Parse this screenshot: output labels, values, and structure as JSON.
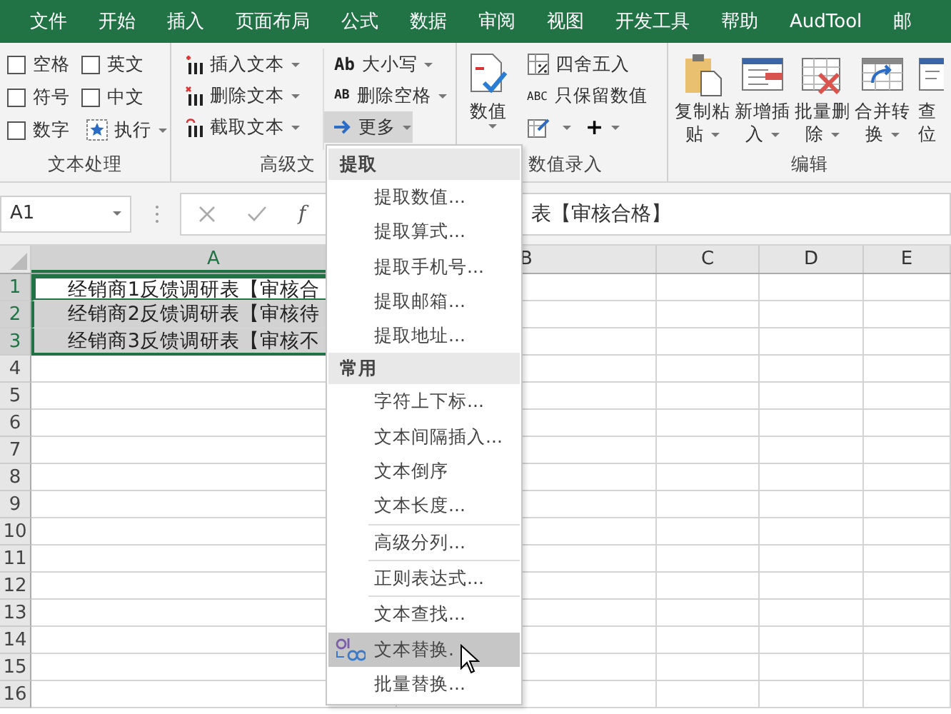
{
  "menu_tabs": [
    "文件",
    "开始",
    "插入",
    "页面布局",
    "公式",
    "数据",
    "审阅",
    "视图",
    "开发工具",
    "帮助",
    "AudTool",
    "邮"
  ],
  "ribbon": {
    "text_group": {
      "label": "文本处理",
      "checkboxes": [
        {
          "label": "空格",
          "checked": false
        },
        {
          "label": "英文",
          "checked": false
        },
        {
          "label": "符号",
          "checked": false
        },
        {
          "label": "中文",
          "checked": false
        },
        {
          "label": "数字",
          "checked": false
        }
      ],
      "run_button": "执行"
    },
    "advanced_group": {
      "label": "高级文",
      "text_buttons": [
        "插入文本",
        "删除文本",
        "截取文本"
      ],
      "case_button": {
        "icon_text": "Ab",
        "label": "大小写"
      },
      "trim_button": {
        "icon_text": "AB",
        "label": "删除空格"
      },
      "more_button": {
        "label": "更多",
        "pressed": true
      }
    },
    "number_group": {
      "label": "数值录入",
      "number_button": "数值",
      "round_button": "四舍五入",
      "keep_numbers_button": {
        "icon_text": "ABC",
        "label": "只保留数值"
      },
      "plus_button": "+"
    },
    "edit_group": {
      "label": "编辑",
      "buttons": [
        {
          "line_1": "复制粘",
          "line_2": "贴",
          "dropdown": true
        },
        {
          "line_1": "新增插",
          "line_2": "入",
          "dropdown": true
        },
        {
          "line_1": "批量删",
          "line_2": "除",
          "dropdown": true
        },
        {
          "line_1": "合并转",
          "line_2": "换",
          "dropdown": true
        },
        {
          "line_1": "查",
          "line_2": "位",
          "dropdown": false
        }
      ]
    }
  },
  "formula_bar": {
    "cell_reference": "A1",
    "function_label": "f",
    "formula_text": "表【审核合格】"
  },
  "columns": [
    {
      "label": "A",
      "selected": true
    },
    {
      "label": "B",
      "selected": false
    },
    {
      "label": "C",
      "selected": false
    },
    {
      "label": "D",
      "selected": false
    },
    {
      "label": "E",
      "selected": false
    }
  ],
  "rows": [
    {
      "number": "1",
      "cell_a": "经销商1反馈调研表【审核合",
      "selected": true,
      "active": true
    },
    {
      "number": "2",
      "cell_a": "经销商2反馈调研表【审核待",
      "selected": true,
      "active": false
    },
    {
      "number": "3",
      "cell_a": "经销商3反馈调研表【审核不",
      "selected": true,
      "active": false
    },
    {
      "number": "4",
      "selected": false,
      "active": false
    },
    {
      "number": "5",
      "selected": false,
      "active": false
    },
    {
      "number": "6",
      "selected": false,
      "active": false
    },
    {
      "number": "7",
      "selected": false,
      "active": false
    },
    {
      "number": "8",
      "selected": false,
      "active": false
    },
    {
      "number": "9",
      "selected": false,
      "active": false
    },
    {
      "number": "10",
      "selected": false,
      "active": false
    },
    {
      "number": "11",
      "selected": false,
      "active": false
    },
    {
      "number": "12",
      "selected": false,
      "active": false
    },
    {
      "number": "13",
      "selected": false,
      "active": false
    },
    {
      "number": "14",
      "selected": false,
      "active": false
    },
    {
      "number": "15",
      "selected": false,
      "active": false
    },
    {
      "number": "16",
      "selected": false,
      "active": false
    }
  ],
  "dropdown_menu": {
    "items": [
      {
        "kind": "header",
        "label": "提取"
      },
      {
        "kind": "item",
        "label": "提取数值...",
        "separator": false,
        "selected": false
      },
      {
        "kind": "item",
        "label": "提取算式...",
        "separator": false,
        "selected": false
      },
      {
        "kind": "item",
        "label": "提取手机号...",
        "separator": false,
        "selected": false
      },
      {
        "kind": "item",
        "label": "提取邮箱...",
        "separator": false,
        "selected": false
      },
      {
        "kind": "item",
        "label": "提取地址...",
        "separator": false,
        "selected": false
      },
      {
        "kind": "header",
        "label": "常用"
      },
      {
        "kind": "item",
        "label": "字符上下标...",
        "separator": false,
        "selected": false
      },
      {
        "kind": "item",
        "label": "文本间隔插入...",
        "separator": false,
        "selected": false
      },
      {
        "kind": "item",
        "label": "文本倒序",
        "separator": false,
        "selected": false
      },
      {
        "kind": "item",
        "label": "文本长度...",
        "separator": false,
        "selected": false
      },
      {
        "kind": "item",
        "label": "高级分列...",
        "separator": true,
        "selected": false
      },
      {
        "kind": "item",
        "label": "正则表达式...",
        "separator": true,
        "selected": false
      },
      {
        "kind": "item",
        "label": "文本查找...",
        "separator": true,
        "selected": false
      },
      {
        "kind": "item",
        "label": "文本替换.",
        "separator": false,
        "selected": true
      },
      {
        "kind": "item",
        "label": "批量替换...",
        "separator": false,
        "selected": false
      }
    ]
  }
}
